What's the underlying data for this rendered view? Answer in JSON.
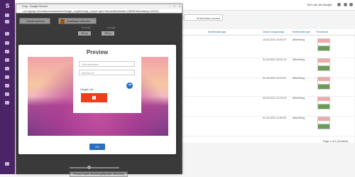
{
  "rail": {
    "logo": "S"
  },
  "topbar": {
    "user_name": "Tom van der Burght"
  },
  "toolbar": {
    "search_placeholder": "Multimedia zoeken"
  },
  "table": {
    "headers": [
      "Multimedia tags",
      "Datum toegevoegd",
      "Multimedia type",
      "Thumbnail"
    ],
    "rows": [
      {
        "date": "15-03-2021 15:40:37",
        "type": "Afbeelding"
      },
      {
        "date": "31-03-2021 15:02:14",
        "type": "Afbeelding"
      },
      {
        "date": "31-03-2021 12:22:21",
        "type": "Afbeelding"
      },
      {
        "date": "09-03-2021 12:24:09",
        "type": "Afbeelding"
      },
      {
        "date": "01-03-2021 11:55:25",
        "type": "Afbeelding"
      }
    ],
    "pager": "Page 1 of 6 (16 items)"
  },
  "browser": {
    "title": "Crop - Google Chrome",
    "url": "crm.cognisp.nl/crm/admin/modules/mm/image_cropper/image_cropper.aspx?selectedMultimedia=1564891&timestamp=202103..."
  },
  "cropper": {
    "btn_restore": "Herstel opnieuw",
    "btn_apply": "Instellingen afronden",
    "width_label": "Breedte",
    "height_label": "Hoogte",
    "width_value": "500 px",
    "height_value": "250 px",
    "crop_button": "Preview maken afbeelding/Bijsnijden afbeelding"
  },
  "preview": {
    "title": "Preview",
    "field1_placeholder": "Gebruikersnaam",
    "field2_placeholder": "Wachtwoord",
    "caption": "Inloggen met",
    "ok": "OK"
  },
  "colors": {
    "rail": "#4a2466",
    "accent": "#2a6ebd",
    "orange": "#ee3d1b"
  }
}
